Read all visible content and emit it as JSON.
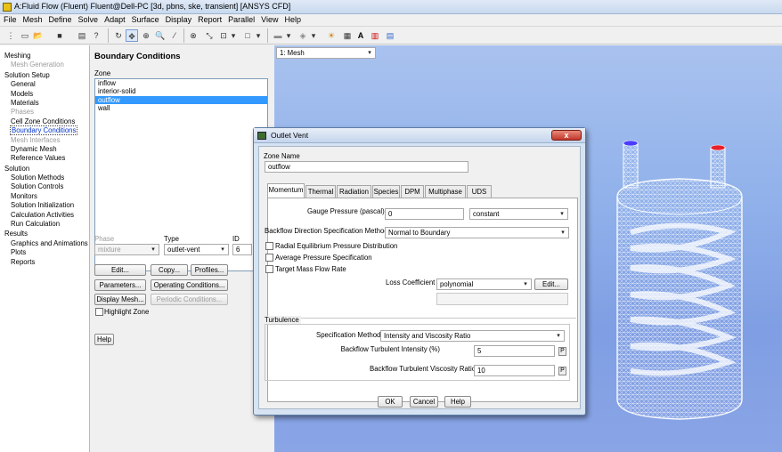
{
  "window": {
    "title": "A:Fluid Flow (Fluent) Fluent@Dell-PC  [3d, pbns, ske, transient] [ANSYS CFD]"
  },
  "menu": [
    "File",
    "Mesh",
    "Define",
    "Solve",
    "Adapt",
    "Surface",
    "Display",
    "Report",
    "Parallel",
    "View",
    "Help"
  ],
  "nav": {
    "items": [
      {
        "label": "Meshing",
        "level": "h",
        "state": "normal"
      },
      {
        "label": "Mesh Generation",
        "level": "i",
        "state": "disabled"
      },
      {
        "label": "Solution Setup",
        "level": "h",
        "state": "normal"
      },
      {
        "label": "General",
        "level": "i",
        "state": "normal"
      },
      {
        "label": "Models",
        "level": "i",
        "state": "normal"
      },
      {
        "label": "Materials",
        "level": "i",
        "state": "normal"
      },
      {
        "label": "Phases",
        "level": "i",
        "state": "disabled"
      },
      {
        "label": "Cell Zone Conditions",
        "level": "i",
        "state": "normal"
      },
      {
        "label": "Boundary Conditions",
        "level": "i",
        "state": "selected"
      },
      {
        "label": "Mesh Interfaces",
        "level": "i",
        "state": "disabled"
      },
      {
        "label": "Dynamic Mesh",
        "level": "i",
        "state": "normal"
      },
      {
        "label": "Reference Values",
        "level": "i",
        "state": "normal"
      },
      {
        "label": "Solution",
        "level": "h",
        "state": "normal"
      },
      {
        "label": "Solution Methods",
        "level": "i",
        "state": "normal"
      },
      {
        "label": "Solution Controls",
        "level": "i",
        "state": "normal"
      },
      {
        "label": "Monitors",
        "level": "i",
        "state": "normal"
      },
      {
        "label": "Solution Initialization",
        "level": "i",
        "state": "normal"
      },
      {
        "label": "Calculation Activities",
        "level": "i",
        "state": "normal"
      },
      {
        "label": "Run Calculation",
        "level": "i",
        "state": "normal"
      },
      {
        "label": "Results",
        "level": "h",
        "state": "normal"
      },
      {
        "label": "Graphics and Animations",
        "level": "i",
        "state": "normal"
      },
      {
        "label": "Plots",
        "level": "i",
        "state": "normal"
      },
      {
        "label": "Reports",
        "level": "i",
        "state": "normal"
      }
    ]
  },
  "boundary_conditions": {
    "title": "Boundary Conditions",
    "zone_label": "Zone",
    "zones": [
      "inflow",
      "interior-solid",
      "outflow",
      "wall"
    ],
    "selected_zone": "outflow",
    "phase_label": "Phase",
    "phase_value": "mixture",
    "type_label": "Type",
    "type_value": "outlet-vent",
    "id_label": "ID",
    "id_value": "6",
    "buttons": {
      "edit": "Edit...",
      "copy": "Copy...",
      "profiles": "Profiles...",
      "parameters": "Parameters...",
      "operating": "Operating Conditions...",
      "display_mesh": "Display Mesh...",
      "periodic": "Periodic Conditions..."
    },
    "highlight_zone": "Highlight Zone",
    "help": "Help"
  },
  "graphics": {
    "window_select": "1: Mesh"
  },
  "dialog": {
    "title": "Outlet Vent",
    "close": "x",
    "zone_name_label": "Zone Name",
    "zone_name_value": "outflow",
    "tabs": [
      "Momentum",
      "Thermal",
      "Radiation",
      "Species",
      "DPM",
      "Multiphase",
      "UDS"
    ],
    "active_tab": "Momentum",
    "gauge_pressure_label": "Gauge Pressure (pascal)",
    "gauge_pressure_value": "0",
    "gauge_pressure_profile": "constant",
    "backflow_method_label": "Backflow Direction Specification Method",
    "backflow_method_value": "Normal to Boundary",
    "checkboxes": [
      "Radial Equilibrium Pressure Distribution",
      "Average Pressure Specification",
      "Target Mass Flow Rate"
    ],
    "loss_coefficient_label": "Loss Coefficient",
    "loss_coefficient_value": "polynomial",
    "loss_edit": "Edit...",
    "turbulence_label": "Turbulence",
    "spec_method_label": "Specification Method",
    "spec_method_value": "Intensity and Viscosity Ratio",
    "turb_intensity_label": "Backflow Turbulent Intensity (%)",
    "turb_intensity_value": "5",
    "turb_viscosity_label": "Backflow Turbulent Viscosity Ratio",
    "turb_viscosity_value": "10",
    "param_button": "P",
    "ok": "OK",
    "cancel": "Cancel",
    "help": "Help"
  },
  "colors": {
    "accent": "#3399ff",
    "inlet": "#4a3cff",
    "outlet": "#e8202a",
    "mesh": "#ffffff"
  }
}
